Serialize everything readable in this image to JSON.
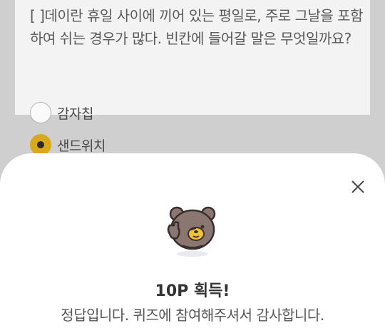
{
  "quiz": {
    "question": "[ ]데이란 휴일 사이에 끼어 있는 평일로, 주로 그날을 포함하여 쉬는 경우가 많다. 빈칸에 들어갈 말은 무엇일까요?",
    "options": [
      {
        "label": "감자칩",
        "selected": false
      },
      {
        "label": "샌드위치",
        "selected": true
      }
    ]
  },
  "result_sheet": {
    "title": "10P 획득!",
    "message": "정답입니다. 퀴즈에 참여해주셔서 감사합니다.",
    "close_icon": "close-icon",
    "mascot": "bear-thumbs-up"
  },
  "colors": {
    "accent": "#d8aa1b",
    "overlay": "#cfcfcf",
    "card": "#f3f3f3",
    "sheet": "#ffffff"
  }
}
